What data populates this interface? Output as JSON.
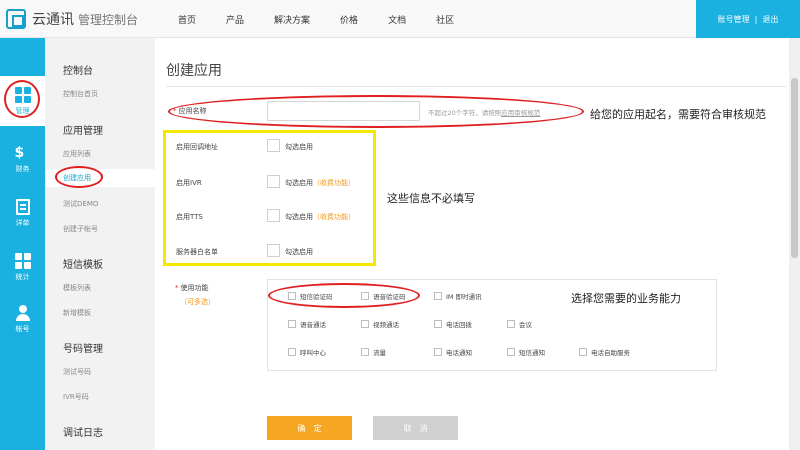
{
  "header": {
    "logo_name": "云通讯",
    "logo_sub": "管理控制台",
    "nav": [
      "首页",
      "产品",
      "解决方案",
      "价格",
      "文档",
      "社区"
    ],
    "account_label": "账号管理",
    "account_sep": "|",
    "logout_label": "退出"
  },
  "rail": [
    {
      "label": "管理",
      "icon": "grid-icon"
    },
    {
      "label": "财务",
      "icon": "bill-icon"
    },
    {
      "label": "详单",
      "icon": "list-icon"
    },
    {
      "label": "统计",
      "icon": "grid-icon"
    },
    {
      "label": "帐号",
      "icon": "user-icon"
    }
  ],
  "subnav": {
    "s1": {
      "title": "控制台",
      "items": [
        "控制台首页"
      ]
    },
    "s2": {
      "title": "应用管理",
      "items": [
        "应用列表",
        "创建应用",
        "测试DEMO",
        "创建子帐号"
      ]
    },
    "s3": {
      "title": "短信模板",
      "items": [
        "模板列表",
        "新增模板"
      ]
    },
    "s4": {
      "title": "号码管理",
      "items": [
        "测试号码",
        "IVR号码"
      ]
    },
    "s5": {
      "title": "调试日志"
    }
  },
  "page": {
    "title": "创建应用",
    "app_name_label": "应用名称",
    "required_mark": "*",
    "app_name_value": "",
    "hint_prefix": "不超过20个字符，请按照",
    "hint_link": "应用审核规范",
    "callback_label": "启用回调地址",
    "callback_check": "勾选启用",
    "ivr_label": "启用IVR",
    "ivr_check": "勾选启用",
    "tts_label": "启用TTS",
    "tts_check": "勾选启用",
    "fee_text": "（收费功能）",
    "whitelist_label": "服务器白名单",
    "whitelist_check": "勾选启用",
    "func_label": "使用功能",
    "func_multi": "（可多选）",
    "functions": [
      [
        "短信验证码",
        "语音验证码",
        "IM 即时通讯"
      ],
      [
        "语音通话",
        "视频通话",
        "电话回拨",
        "会议"
      ],
      [
        "呼叫中心",
        "流量",
        "电话通知",
        "短信通知",
        "电话自助服务"
      ]
    ],
    "confirm": "确　定",
    "cancel": "取　消"
  },
  "annotations": {
    "name_note": "给您的应用起名，需要符合审核规范",
    "optional_note": "这些信息不必填写",
    "func_note": "选择您需要的业务能力"
  },
  "colors": {
    "primary": "#1ab0e0",
    "orange": "#f5a623",
    "annotation_red": "#e02020",
    "annotation_yellow": "#f5e800"
  }
}
